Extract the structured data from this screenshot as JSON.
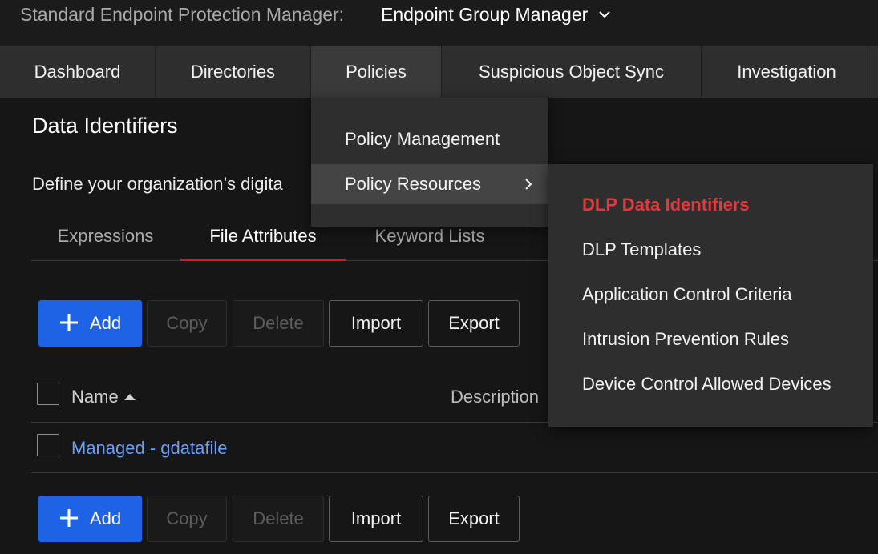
{
  "topbar": {
    "app_name": "Standard Endpoint Protection Manager:",
    "product": "Endpoint Group Manager",
    "product_icon": "chevron-down-icon"
  },
  "nav": {
    "items": [
      {
        "label": "Dashboard",
        "active": false
      },
      {
        "label": "Directories",
        "active": false
      },
      {
        "label": "Policies",
        "active": true
      },
      {
        "label": "Suspicious Object Sync",
        "active": false
      },
      {
        "label": "Investigation",
        "active": false
      }
    ]
  },
  "main": {
    "title": "Data Identifiers",
    "description": "Define your organization’s digita",
    "tabs": [
      {
        "label": "Expressions",
        "active": false
      },
      {
        "label": "File Attributes",
        "active": true
      },
      {
        "label": "Keyword Lists",
        "active": false
      }
    ],
    "toolbar": {
      "add": "Add",
      "copy": "Copy",
      "delete": "Delete",
      "import": "Import",
      "export": "Export"
    },
    "table": {
      "columns": [
        "Name",
        "Description"
      ],
      "sort_column": "Name",
      "sort_direction": "ascending",
      "rows": [
        {
          "name": "Managed - gdatafile",
          "selected": false
        }
      ]
    }
  },
  "menus": {
    "policies": {
      "items": [
        {
          "label": "Policy Management",
          "has_submenu": false
        },
        {
          "label": "Policy Resources",
          "has_submenu": true,
          "hovered": true
        }
      ]
    },
    "policy_resources": {
      "items": [
        {
          "label": "DLP Data Identifiers",
          "active": true
        },
        {
          "label": "DLP Templates",
          "active": false
        },
        {
          "label": "Application Control Criteria",
          "active": false
        },
        {
          "label": "Intrusion Prevention Rules",
          "active": false
        },
        {
          "label": "Device Control Allowed Devices",
          "active": false
        }
      ]
    }
  },
  "colors": {
    "accent_red": "#d71920",
    "active_menu_item": "#e03a3e",
    "primary_button": "#1e63e5",
    "link": "#6f9ef5",
    "background": "#161616"
  }
}
